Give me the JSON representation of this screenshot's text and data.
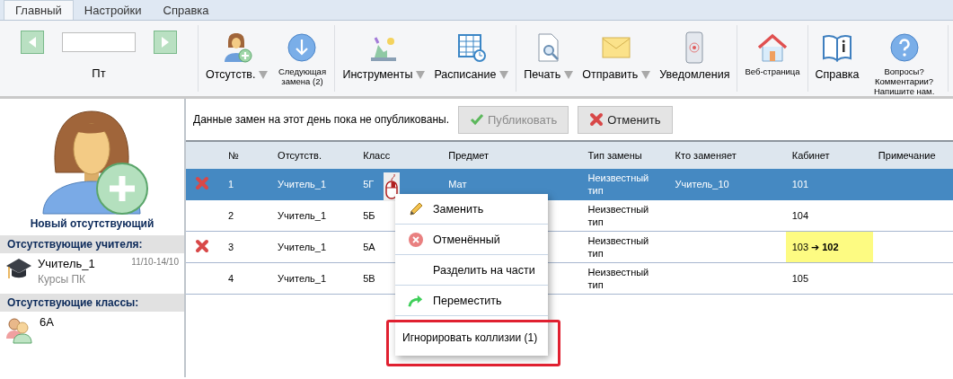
{
  "tabs": [
    {
      "label": "Главный",
      "selected": true
    },
    {
      "label": "Настройки",
      "selected": false
    },
    {
      "label": "Справка",
      "selected": false
    }
  ],
  "ribbon": {
    "date_caption": "Пт",
    "groups": [
      {
        "items": [
          {
            "label": "Отсутств.",
            "kind": "large",
            "dropdown": true
          },
          {
            "label": "Следующая замена (2)",
            "kind": "small",
            "dropdown": false
          }
        ]
      },
      {
        "items": [
          {
            "label": "Инструменты",
            "kind": "large",
            "dropdown": true
          },
          {
            "label": "Расписание",
            "kind": "large",
            "dropdown": true
          }
        ]
      },
      {
        "items": [
          {
            "label": "Печать",
            "kind": "large",
            "dropdown": true
          },
          {
            "label": "Отправить",
            "kind": "large",
            "dropdown": true
          },
          {
            "label": "Уведомления",
            "kind": "large",
            "dropdown": false
          }
        ]
      },
      {
        "items": [
          {
            "label": "Веб-страница",
            "kind": "small",
            "dropdown": false
          }
        ]
      },
      {
        "items": [
          {
            "label": "Справка",
            "kind": "large",
            "dropdown": false
          },
          {
            "label": "Вопросы? Комментарии? Напишите нам.",
            "kind": "small",
            "dropdown": false
          }
        ]
      }
    ]
  },
  "sidebar": {
    "new_absence": "Новый отсутствующий",
    "teachers_header": "Отсутствующие учителя:",
    "teachers": [
      {
        "name": "Учитель_1",
        "dates": "11/10-14/10",
        "reason": "Курсы ПК"
      }
    ],
    "classes_header": "Отсутствующие классы:",
    "classes": [
      {
        "name": "6А"
      }
    ]
  },
  "notice": "Данные замен на этот день пока не опубликованы.",
  "actions": [
    {
      "label": "Публиковать",
      "kind": "publish",
      "disabled": true
    },
    {
      "label": "Отменить",
      "kind": "cancel",
      "disabled": false
    }
  ],
  "table": {
    "columns": [
      "№",
      "Отсутств.",
      "Класс",
      "Предмет",
      "Тип замены",
      "Кто заменяет",
      "Кабинет",
      "Примечание"
    ],
    "rows": [
      {
        "selected": true,
        "cancelled": true,
        "cells": [
          "1",
          "Учитель_1",
          "5Г",
          "Мат",
          "Неизвестный тип",
          "Учитель_10",
          "101",
          ""
        ],
        "room_changed": false
      },
      {
        "selected": false,
        "cancelled": false,
        "cells": [
          "2",
          "Учитель_1",
          "5Б",
          "",
          "Неизвестный тип",
          "",
          "104",
          ""
        ],
        "room_changed": false
      },
      {
        "selected": false,
        "cancelled": true,
        "cells": [
          "3",
          "Учитель_1",
          "5А",
          "",
          "Неизвестный тип",
          "",
          "103 ➔ **102**",
          ""
        ],
        "room_changed": true
      },
      {
        "selected": false,
        "cancelled": false,
        "cells": [
          "4",
          "Учитель_1",
          "5В",
          "",
          "Неизвестный тип",
          "",
          "105",
          ""
        ],
        "room_changed": false
      }
    ]
  },
  "context_menu": [
    {
      "label": "Заменить",
      "kind": "edit",
      "highlighted": false
    },
    {
      "label": "Отменённый",
      "kind": "cancel",
      "highlighted": false
    },
    {
      "label": "Разделить на части",
      "kind": "plain",
      "highlighted": false
    },
    {
      "label": "Переместить",
      "kind": "move",
      "highlighted": false
    },
    {
      "label": "Игнорировать коллизии (1)",
      "kind": "footer",
      "highlighted": true
    }
  ]
}
